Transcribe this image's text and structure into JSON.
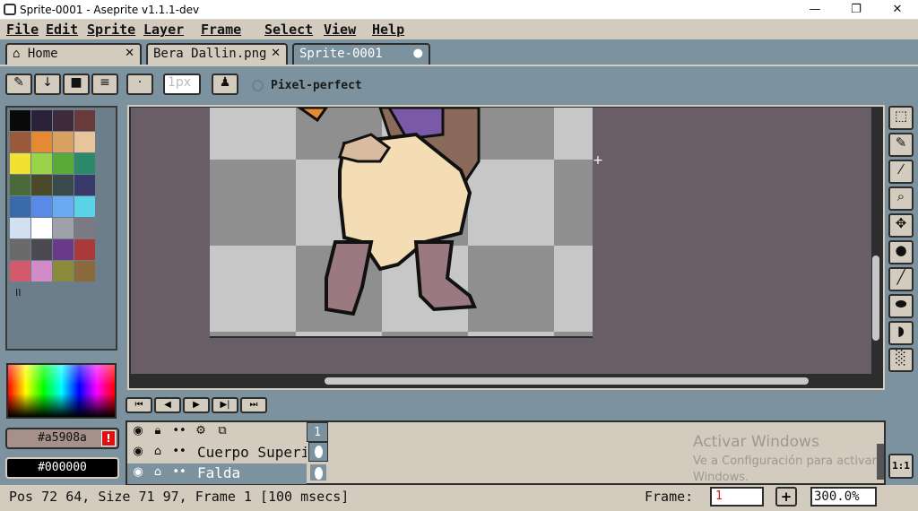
{
  "window": {
    "title": "Sprite-0001 - Aseprite v1.1.1-dev",
    "minimize": "—",
    "maximize": "❐",
    "close": "✕"
  },
  "menu": [
    "File",
    "Edit",
    "Sprite",
    "Layer",
    "Frame",
    "Select",
    "View",
    "Help"
  ],
  "tabs": [
    {
      "label": "Home",
      "close": "✕"
    },
    {
      "label": "Bera Dallin.png",
      "close": "✕"
    },
    {
      "label": "Sprite-0001",
      "close": "●"
    }
  ],
  "context_bar": {
    "brush_size": "1px",
    "pixel_perfect_label": "Pixel-perfect"
  },
  "palette": {
    "colors": [
      "#0a0a0a",
      "#2a2338",
      "#3d2a3c",
      "#6a3a3a",
      "#9a5a3a",
      "#e58a33",
      "#d9a060",
      "#e8c49a",
      "#f2e033",
      "#9ad24a",
      "#5aaa3a",
      "#2a8a6a",
      "#4a6a3a",
      "#4a4a2a",
      "#3a4a4a",
      "#3a3a6a",
      "#3a6aaa",
      "#5a8ae8",
      "#6aaaf2",
      "#5ad2e8",
      "#d2e0f2",
      "#ffffff",
      "#a0a0a8",
      "#7a7a82",
      "#6a6a6a",
      "#4a4a50",
      "#6a3a8a",
      "#aa3a3a",
      "#d25a6a",
      "#d28ac8",
      "#8a8a3a",
      "#8a6a3a"
    ],
    "mode_label": "II"
  },
  "colors": {
    "foreground": "#a5908a",
    "background": "#000000"
  },
  "timeline": {
    "frame_header": "1",
    "layers": [
      {
        "name": "Cuerpo Superior"
      },
      {
        "name": "Falda"
      }
    ]
  },
  "status": {
    "text": "Pos 72 64, Size 71 97, Frame 1 [100 msecs]",
    "frame_label": "Frame:",
    "frame_value": "1",
    "add_frame": "+",
    "zoom": "300.0%"
  },
  "zoom_button": "1:1",
  "watermark": {
    "title": "Activar Windows",
    "subtitle": "Ve a Configuración para activar",
    "subtitle2": "Windows."
  }
}
